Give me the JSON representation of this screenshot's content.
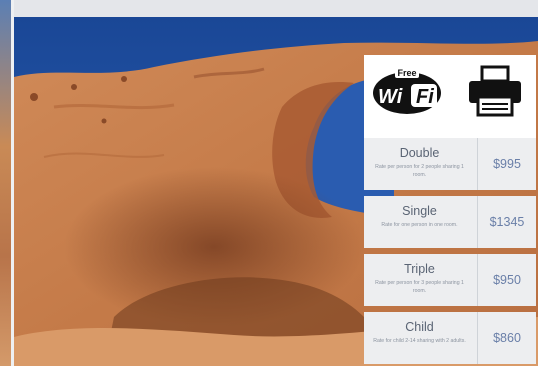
{
  "amenities": {
    "wifi": {
      "icon": "wifi-icon",
      "label": "Free Wi-Fi"
    },
    "printer": {
      "icon": "printer-icon"
    }
  },
  "rates": [
    {
      "name": "Double",
      "description": "Rate per person for 2 people sharing 1 room.",
      "price": "$995"
    },
    {
      "name": "Single",
      "description": "Rate for one person in one room.",
      "price": "$1345"
    },
    {
      "name": "Triple",
      "description": "Rate per person for 3 people sharing 1 room.",
      "price": "$950"
    },
    {
      "name": "Child",
      "description": "Rate for child 2-14 sharing with 2 adults.",
      "price": "$860"
    }
  ],
  "colors": {
    "sky": "#1d4d9e",
    "rock": "#c9804e",
    "panel_bg": "#edeef0",
    "price_text": "#6a7fa8"
  }
}
